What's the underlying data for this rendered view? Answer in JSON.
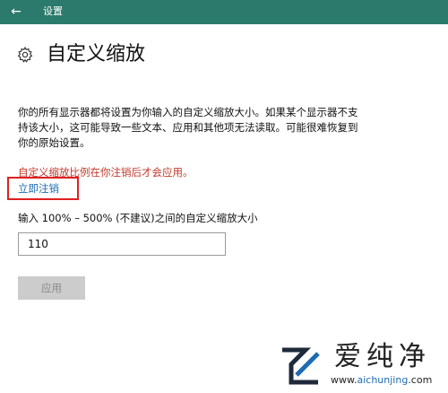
{
  "window": {
    "title": "设置",
    "back_icon": "back-arrow-icon",
    "title_bar_color": "#2c7a6c"
  },
  "header": {
    "icon": "gear-icon",
    "title": "自定义缩放"
  },
  "description": "你的所有显示器都将设置为你输入的自定义缩放大小。如果某个显示器不支持该大小，这可能导致一些文本、应用和其他项无法读取。可能很难恢复到你的原始设置。",
  "warning": {
    "text": "自定义缩放比例在你注销后才会应用。",
    "color": "#c0392b"
  },
  "signout_link": {
    "label": "立即注销",
    "color": "#1d6bb3"
  },
  "scale": {
    "label": "输入 100% – 500% (不建议)之间的自定义缩放大小",
    "value": "110"
  },
  "apply_button": {
    "label": "应用"
  },
  "watermark": {
    "brand": "爱纯净",
    "site_pre": "www.",
    "site_highlight": "aichunjing",
    "site_post": ".com"
  }
}
